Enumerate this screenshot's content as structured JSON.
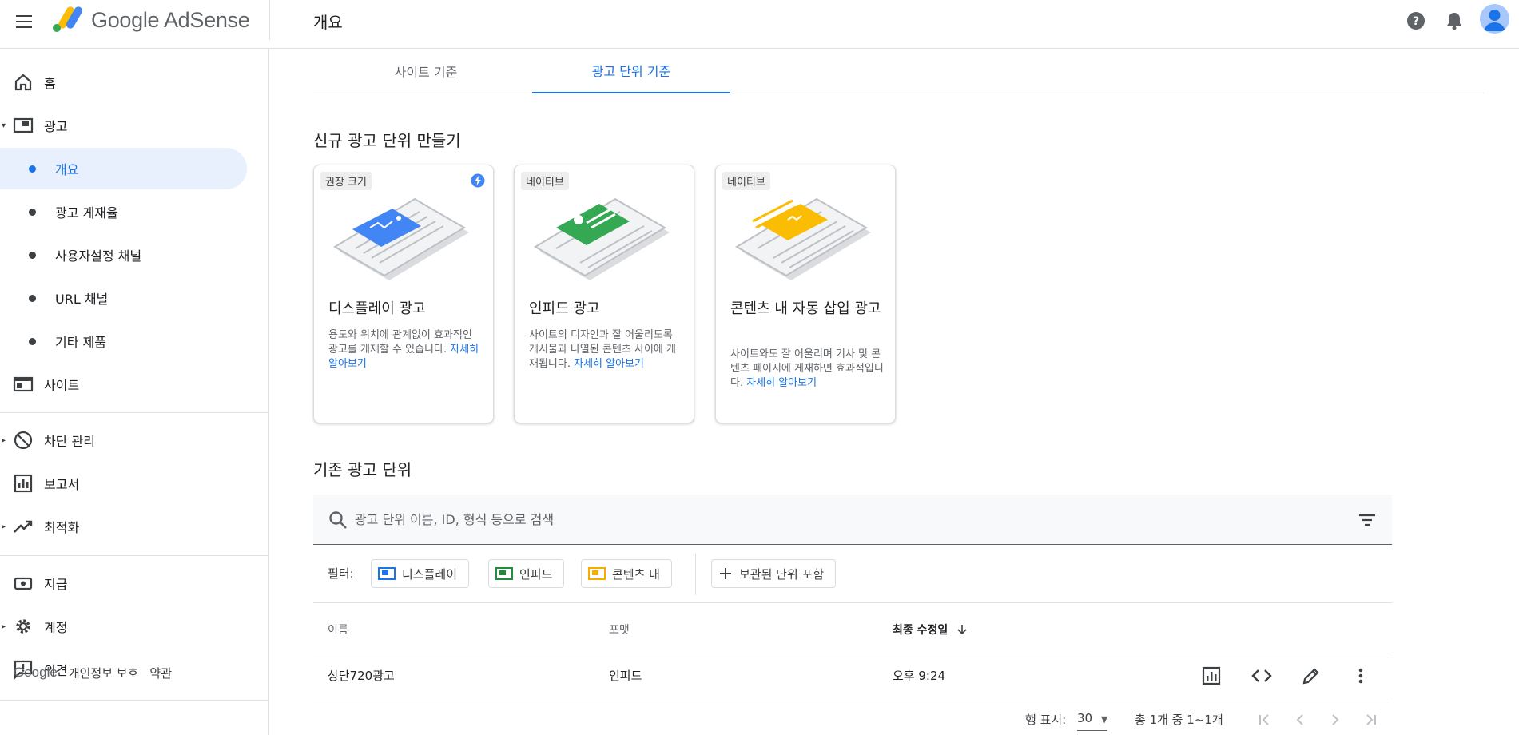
{
  "header": {
    "brand": "Google AdSense",
    "page_title": "개요"
  },
  "sidebar": {
    "items": [
      {
        "label": "홈"
      },
      {
        "label": "광고"
      },
      {
        "label": "개요"
      },
      {
        "label": "광고 게재율"
      },
      {
        "label": "사용자설정 채널"
      },
      {
        "label": "URL 채널"
      },
      {
        "label": "기타 제품"
      },
      {
        "label": "사이트"
      },
      {
        "label": "차단 관리"
      },
      {
        "label": "보고서"
      },
      {
        "label": "최적화"
      },
      {
        "label": "지급"
      },
      {
        "label": "계정"
      },
      {
        "label": "의견"
      }
    ],
    "footer": {
      "google": "Google",
      "privacy": "개인정보 보호",
      "terms": "약관"
    }
  },
  "tabs": [
    {
      "label": "사이트 기준"
    },
    {
      "label": "광고 단위 기준"
    }
  ],
  "create_section": {
    "title": "신규 광고 단위 만들기",
    "cards": [
      {
        "chip": "권장 크기",
        "title": "디스플레이 광고",
        "desc": "용도와 위치에 관계없이 효과적인 광고를 게재할 수 있습니다.",
        "link": "자세히 알아보기"
      },
      {
        "chip": "네이티브",
        "title": "인피드 광고",
        "desc": "사이트의 디자인과 잘 어울리도록 게시물과 나열된 콘텐츠 사이에 게재됩니다.",
        "link": "자세히 알아보기"
      },
      {
        "chip": "네이티브",
        "title": "콘텐츠 내 자동 삽입 광고",
        "desc": "사이트와도 잘 어울리며 기사 및 콘텐츠 페이지에 게재하면 효과적입니다.",
        "link": "자세히 알아보기"
      }
    ]
  },
  "existing_section": {
    "title": "기존 광고 단위",
    "search_placeholder": "광고 단위 이름, ID, 형식 등으로 검색",
    "filter_label": "필터:",
    "filter_chips": [
      {
        "label": "디스플레이",
        "color": "#1a73e8"
      },
      {
        "label": "인피드",
        "color": "#1e8e3e"
      },
      {
        "label": "콘텐츠 내",
        "color": "#f9ab00"
      }
    ],
    "archived_chip": "보관된 단위 포함",
    "columns": {
      "name": "이름",
      "format": "포맷",
      "modified": "최종 수정일"
    },
    "rows": [
      {
        "name": "상단720광고",
        "format": "인피드",
        "modified": "오후 9:24"
      }
    ],
    "pager": {
      "rows_label": "행 표시:",
      "rows_value": "30",
      "range": "총 1개 중 1~1개"
    }
  },
  "colors": {
    "accent": "#1a73e8",
    "active_bg": "#e8f0fe"
  }
}
